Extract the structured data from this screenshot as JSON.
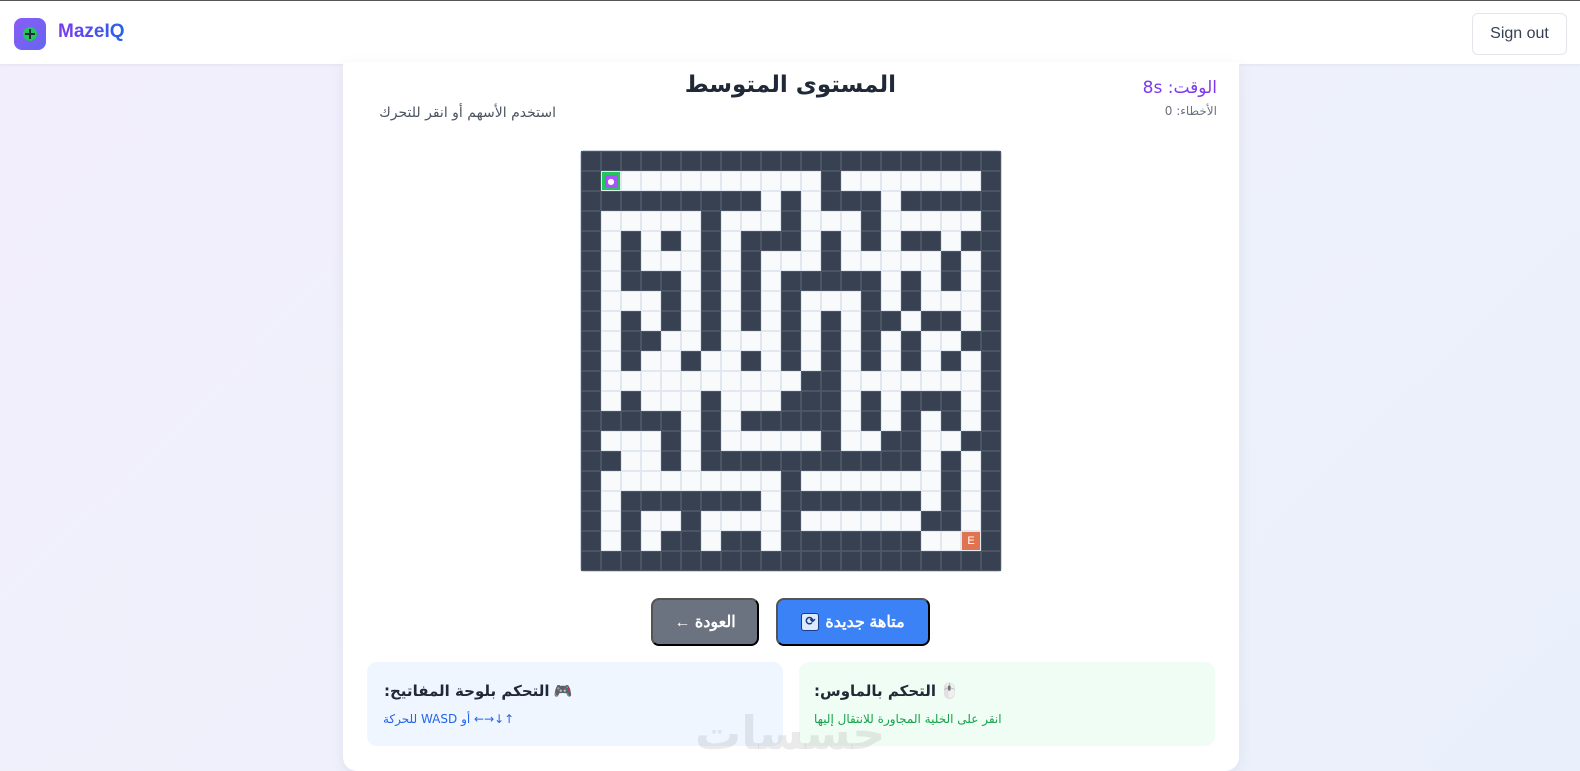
{
  "app": {
    "brand": "MazeIQ",
    "sign_out": "Sign out"
  },
  "game": {
    "title": "المستوى المتوسط",
    "subtitle": "استخدم الأسهم أو انقر للتحرك",
    "timer": "الوقت: 8s",
    "errors": "الأخطاء: 0",
    "exit_label": "E"
  },
  "maze": {
    "rows": [
      "#####################",
      "#P..........#.......#",
      "#########.#.###.#####",
      "#.....#...#...#.....#",
      "#.#.#.#.###.#.#.##.##",
      "#.#...#.#...#.....#.#",
      "#.###.#.#.#####.#.#.#",
      "#...#.#.#.#...#.#...#",
      "#.#.#.#.#.#.#.##.##.#",
      "#.##..#...#.#.#.#..##",
      "#.#..#..#.#.#.#.#.#.#",
      "#..........##.......#",
      "#.#...#...###.#.###.#",
      "#####.#.#####.#.#.#.#",
      "#...#.#.....#..##..##",
      "##..#.###########.#.#",
      "#.........#.......#.#",
      "#.#######.#######.#.#",
      "#.#..#....#......##.#",
      "#.#.##.##.#######...#",
      "#####################"
    ],
    "wall_color": "#374151",
    "path_color": "#f8fafc",
    "player_color": "#22c55e",
    "exit_color": "#e07350"
  },
  "buttons": {
    "new_maze": "متاهة جديدة",
    "back": "العودة ←"
  },
  "controls": {
    "keyboard": {
      "title": "التحكم بلوحة المفاتيح:",
      "text": "للحركة WASD أو ←→↓↑",
      "icon": "gamepad-icon"
    },
    "mouse": {
      "title": "التحكم بالماوس:",
      "text": "انقر على الخلية المجاورة للانتقال إليها",
      "icon": "mouse-icon"
    }
  },
  "watermark": "حسسات"
}
